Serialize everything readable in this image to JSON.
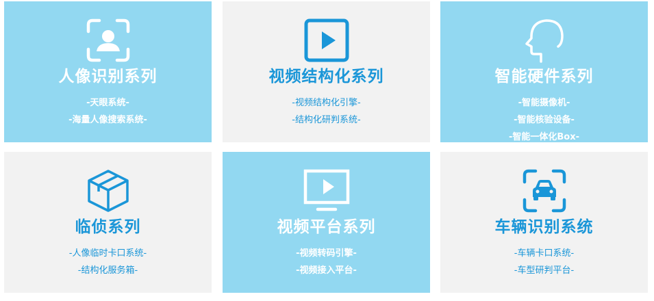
{
  "cards": [
    {
      "title": "人像识别系列",
      "icon": "face-recognition-icon",
      "items": [
        "-天眼系统-",
        "-海量人像搜索系统-"
      ]
    },
    {
      "title": "视频结构化系列",
      "icon": "video-play-icon",
      "items": [
        "-视频结构化引擎-",
        "-结构化研判系统-"
      ]
    },
    {
      "title": "智能硬件系列",
      "icon": "human-head-icon",
      "items": [
        "-智能摄像机-",
        "-智能核验设备-",
        "-智能一体化Box-"
      ]
    },
    {
      "title": "临侦系列",
      "icon": "box-cube-icon",
      "items": [
        "-人像临时卡口系统-",
        "-结构化服务箱-"
      ]
    },
    {
      "title": "视频平台系列",
      "icon": "monitor-play-icon",
      "items": [
        "-视频转码引擎-",
        "-视频接入平台-"
      ]
    },
    {
      "title": "车辆识别系统",
      "icon": "car-recognition-icon",
      "items": [
        "-车辆卡口系统-",
        "-车型研判平台-"
      ]
    }
  ],
  "colors": {
    "blue_card": "#92d8f1",
    "grey_card": "#f2f2f2",
    "accent": "#1a96d8",
    "white": "#ffffff"
  }
}
